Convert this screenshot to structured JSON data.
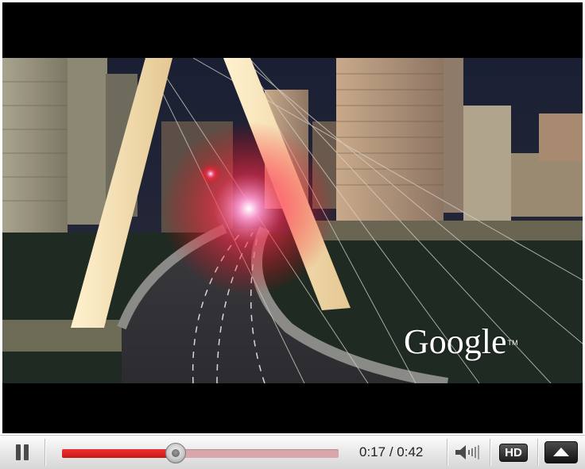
{
  "player": {
    "watermark_text": "Google",
    "watermark_mark": "TM",
    "progress_fraction": 0.41,
    "time": {
      "current": "0:17",
      "separator": " / ",
      "total": "0:42"
    },
    "hd_label": "HD",
    "icons": {
      "pause": "pause-icon",
      "volume": "speaker-volume-icon",
      "expand": "triangle-up-icon"
    },
    "colors": {
      "progress_played": "#e02020",
      "progress_buffered": "#d9a7aa",
      "bar_bg": "#e6e6e6"
    }
  }
}
